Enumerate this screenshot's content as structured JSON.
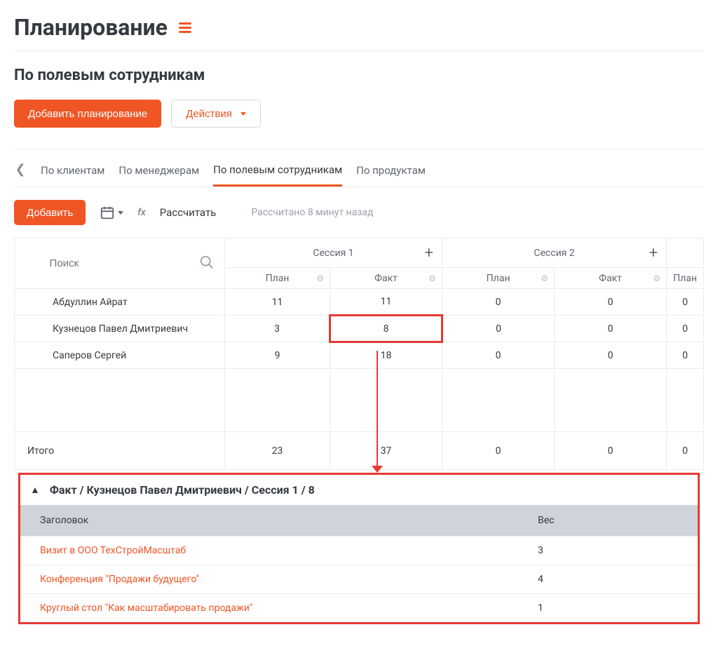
{
  "page_title": "Планирование",
  "subtitle": "По полевым сотрудникам",
  "buttons": {
    "add_planning": "Добавить планирование",
    "actions": "Действия",
    "add": "Добавить",
    "calculate": "Рассчитать"
  },
  "tabs": {
    "clients": "По клиентам",
    "managers": "По менеджерам",
    "field": "По полевым сотрудникам",
    "products": "По продуктам"
  },
  "fx_label": "fx",
  "calc_status": "Рассчитано 8 минут назад",
  "search_placeholder": "Поиск",
  "sessions": {
    "s1": "Сессия 1",
    "s2": "Сессия 2"
  },
  "col": {
    "plan": "План",
    "fact": "Факт"
  },
  "rows": [
    {
      "name": "Абдуллин Айрат",
      "s1_plan": "11",
      "s1_fact": "11",
      "s2_plan": "0",
      "s2_fact": "0",
      "s3_plan": "0"
    },
    {
      "name": "Кузнецов Павел Дмитриевич",
      "s1_plan": "3",
      "s1_fact": "8",
      "s2_plan": "0",
      "s2_fact": "0",
      "s3_plan": "0"
    },
    {
      "name": "Саперов Сергей",
      "s1_plan": "9",
      "s1_fact": "18",
      "s2_plan": "0",
      "s2_fact": "0",
      "s3_plan": "0"
    }
  ],
  "totals": {
    "label": "Итого",
    "s1_plan": "23",
    "s1_fact": "37",
    "s2_plan": "0",
    "s2_fact": "0",
    "s3_plan": "0"
  },
  "detail": {
    "title": "Факт / Кузнецов Павел Дмитриевич / Сессия 1 / 8",
    "head_title": "Заголовок",
    "head_weight": "Вес",
    "items": [
      {
        "title": "Визит в ООО ТехСтройМасштаб",
        "weight": "3"
      },
      {
        "title": "Конференция \"Продажи будущего\"",
        "weight": "4"
      },
      {
        "title": "Круглый стол \"Как масштабировать продажи\"",
        "weight": "1"
      }
    ]
  }
}
